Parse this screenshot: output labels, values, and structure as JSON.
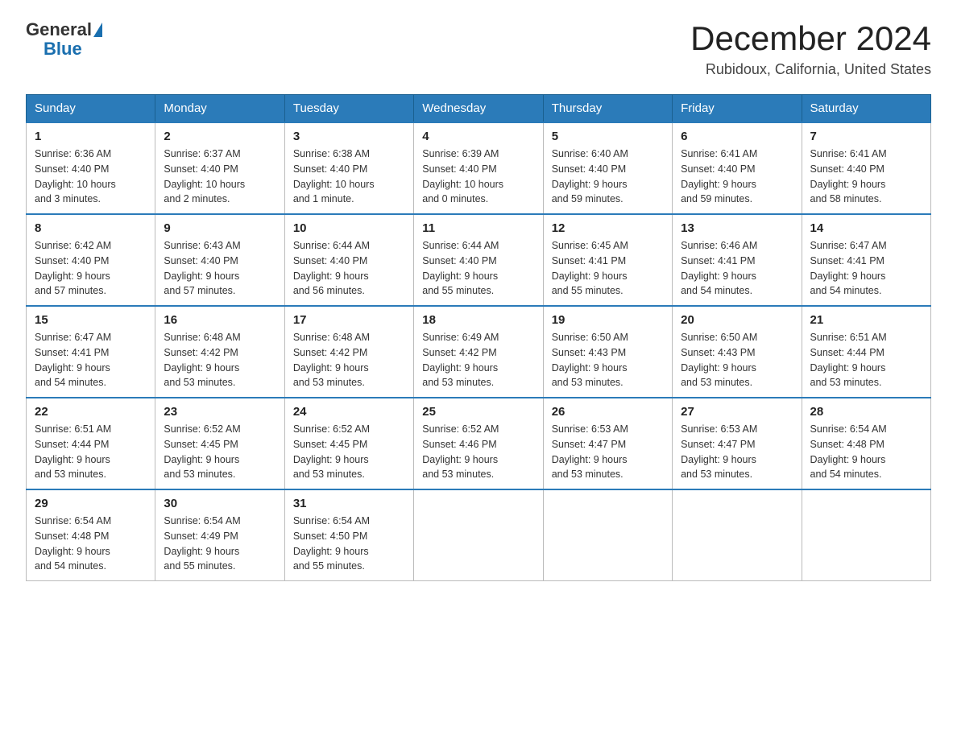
{
  "header": {
    "logo_general": "General",
    "logo_blue": "Blue",
    "title": "December 2024",
    "subtitle": "Rubidoux, California, United States"
  },
  "days_of_week": [
    "Sunday",
    "Monday",
    "Tuesday",
    "Wednesday",
    "Thursday",
    "Friday",
    "Saturday"
  ],
  "weeks": [
    [
      {
        "day": "1",
        "sunrise": "6:36 AM",
        "sunset": "4:40 PM",
        "daylight": "10 hours and 3 minutes."
      },
      {
        "day": "2",
        "sunrise": "6:37 AM",
        "sunset": "4:40 PM",
        "daylight": "10 hours and 2 minutes."
      },
      {
        "day": "3",
        "sunrise": "6:38 AM",
        "sunset": "4:40 PM",
        "daylight": "10 hours and 1 minute."
      },
      {
        "day": "4",
        "sunrise": "6:39 AM",
        "sunset": "4:40 PM",
        "daylight": "10 hours and 0 minutes."
      },
      {
        "day": "5",
        "sunrise": "6:40 AM",
        "sunset": "4:40 PM",
        "daylight": "9 hours and 59 minutes."
      },
      {
        "day": "6",
        "sunrise": "6:41 AM",
        "sunset": "4:40 PM",
        "daylight": "9 hours and 59 minutes."
      },
      {
        "day": "7",
        "sunrise": "6:41 AM",
        "sunset": "4:40 PM",
        "daylight": "9 hours and 58 minutes."
      }
    ],
    [
      {
        "day": "8",
        "sunrise": "6:42 AM",
        "sunset": "4:40 PM",
        "daylight": "9 hours and 57 minutes."
      },
      {
        "day": "9",
        "sunrise": "6:43 AM",
        "sunset": "4:40 PM",
        "daylight": "9 hours and 57 minutes."
      },
      {
        "day": "10",
        "sunrise": "6:44 AM",
        "sunset": "4:40 PM",
        "daylight": "9 hours and 56 minutes."
      },
      {
        "day": "11",
        "sunrise": "6:44 AM",
        "sunset": "4:40 PM",
        "daylight": "9 hours and 55 minutes."
      },
      {
        "day": "12",
        "sunrise": "6:45 AM",
        "sunset": "4:41 PM",
        "daylight": "9 hours and 55 minutes."
      },
      {
        "day": "13",
        "sunrise": "6:46 AM",
        "sunset": "4:41 PM",
        "daylight": "9 hours and 54 minutes."
      },
      {
        "day": "14",
        "sunrise": "6:47 AM",
        "sunset": "4:41 PM",
        "daylight": "9 hours and 54 minutes."
      }
    ],
    [
      {
        "day": "15",
        "sunrise": "6:47 AM",
        "sunset": "4:41 PM",
        "daylight": "9 hours and 54 minutes."
      },
      {
        "day": "16",
        "sunrise": "6:48 AM",
        "sunset": "4:42 PM",
        "daylight": "9 hours and 53 minutes."
      },
      {
        "day": "17",
        "sunrise": "6:48 AM",
        "sunset": "4:42 PM",
        "daylight": "9 hours and 53 minutes."
      },
      {
        "day": "18",
        "sunrise": "6:49 AM",
        "sunset": "4:42 PM",
        "daylight": "9 hours and 53 minutes."
      },
      {
        "day": "19",
        "sunrise": "6:50 AM",
        "sunset": "4:43 PM",
        "daylight": "9 hours and 53 minutes."
      },
      {
        "day": "20",
        "sunrise": "6:50 AM",
        "sunset": "4:43 PM",
        "daylight": "9 hours and 53 minutes."
      },
      {
        "day": "21",
        "sunrise": "6:51 AM",
        "sunset": "4:44 PM",
        "daylight": "9 hours and 53 minutes."
      }
    ],
    [
      {
        "day": "22",
        "sunrise": "6:51 AM",
        "sunset": "4:44 PM",
        "daylight": "9 hours and 53 minutes."
      },
      {
        "day": "23",
        "sunrise": "6:52 AM",
        "sunset": "4:45 PM",
        "daylight": "9 hours and 53 minutes."
      },
      {
        "day": "24",
        "sunrise": "6:52 AM",
        "sunset": "4:45 PM",
        "daylight": "9 hours and 53 minutes."
      },
      {
        "day": "25",
        "sunrise": "6:52 AM",
        "sunset": "4:46 PM",
        "daylight": "9 hours and 53 minutes."
      },
      {
        "day": "26",
        "sunrise": "6:53 AM",
        "sunset": "4:47 PM",
        "daylight": "9 hours and 53 minutes."
      },
      {
        "day": "27",
        "sunrise": "6:53 AM",
        "sunset": "4:47 PM",
        "daylight": "9 hours and 53 minutes."
      },
      {
        "day": "28",
        "sunrise": "6:54 AM",
        "sunset": "4:48 PM",
        "daylight": "9 hours and 54 minutes."
      }
    ],
    [
      {
        "day": "29",
        "sunrise": "6:54 AM",
        "sunset": "4:48 PM",
        "daylight": "9 hours and 54 minutes."
      },
      {
        "day": "30",
        "sunrise": "6:54 AM",
        "sunset": "4:49 PM",
        "daylight": "9 hours and 55 minutes."
      },
      {
        "day": "31",
        "sunrise": "6:54 AM",
        "sunset": "4:50 PM",
        "daylight": "9 hours and 55 minutes."
      },
      null,
      null,
      null,
      null
    ]
  ],
  "labels": {
    "sunrise": "Sunrise:",
    "sunset": "Sunset:",
    "daylight": "Daylight:"
  }
}
